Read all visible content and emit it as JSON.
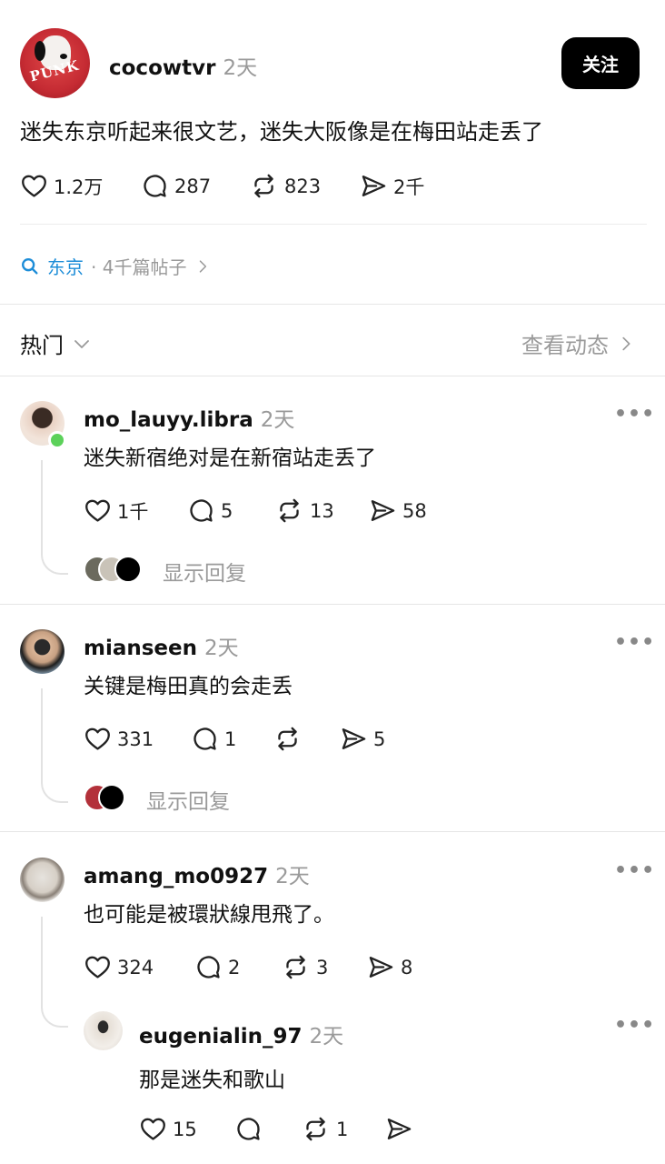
{
  "post": {
    "author": "cocowtvr",
    "time": "2天",
    "follow_label": "关注",
    "avatar_text": "PUNK",
    "text": "迷失东京听起来很文艺，迷失大阪像是在梅田站走丢了",
    "likes": "1.2万",
    "comments": "287",
    "reposts": "823",
    "shares": "2千"
  },
  "topic": {
    "name": "东京",
    "meta": "· 4千篇帖子"
  },
  "sort": {
    "label": "热门",
    "view_activity": "查看动态"
  },
  "comments": [
    {
      "author": "mo_lauyy.libra",
      "time": "2天",
      "text": "迷失新宿绝对是在新宿站走丢了",
      "likes": "1千",
      "replies": "5",
      "reposts": "13",
      "shares": "58",
      "show_replies": "显示回复"
    },
    {
      "author": "mianseen",
      "time": "2天",
      "text": "关键是梅田真的会走丢",
      "likes": "331",
      "replies": "1",
      "reposts": "",
      "shares": "5",
      "show_replies": "显示回复"
    },
    {
      "author": "amang_mo0927",
      "time": "2天",
      "text": "也可能是被環狀線甩飛了。",
      "likes": "324",
      "replies": "2",
      "reposts": "3",
      "shares": "8"
    }
  ],
  "reply": {
    "author": "eugenialin_97",
    "time": "2天",
    "text": "那是迷失和歌山",
    "likes": "15",
    "replies": "",
    "reposts": "1",
    "shares": ""
  },
  "more_label": "•••",
  "colors": {
    "accent": "#1d8dd8",
    "online": "#5cd15a",
    "muted": "#9a9a9a"
  }
}
